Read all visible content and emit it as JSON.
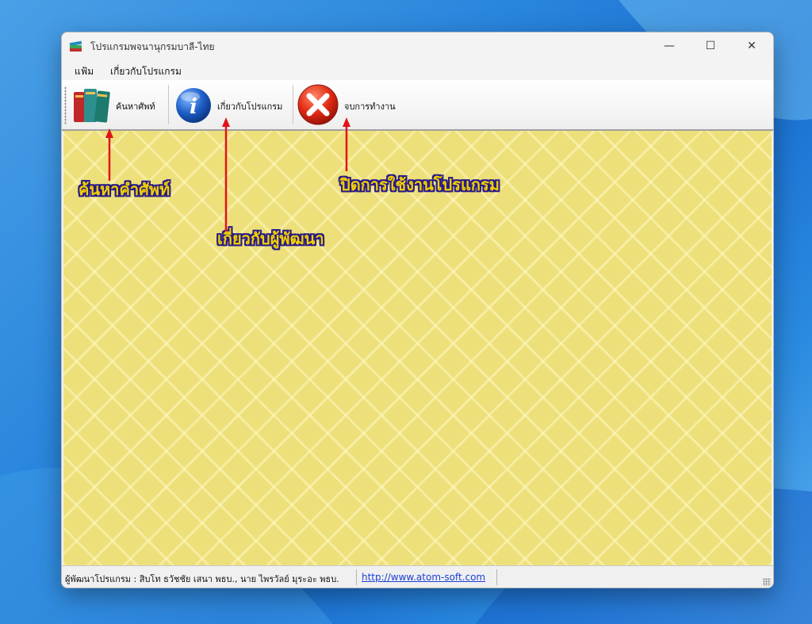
{
  "window": {
    "title": "โปรแกรมพจนานุกรมบาลี-ไทย",
    "controls": {
      "minimize": "—",
      "maximize": "☐",
      "close": "✕"
    }
  },
  "menu": {
    "items": [
      {
        "label": "แฟ้ม"
      },
      {
        "label": "เกี่ยวกับโปรแกรม"
      }
    ]
  },
  "toolbar": {
    "search_label": "ค้นหาศัพท์",
    "about_label": "เกี่ยวกับโปรแกรม",
    "exit_label": "จบการทำงาน"
  },
  "annotations": {
    "search": "ค้นหาคำศัพท์",
    "about": "เกี่ยวกับผู้พัฒนา",
    "exit": "ปิดการใช้งานโปรแกรม"
  },
  "status": {
    "developer": "ผู้พัฒนาโปรแกรม : สิบโท ธวัชชัย  เสนา พธบ., นาย ไพรวัลย์  มุระอะ พธบ.",
    "link": "http://www.atom-soft.com"
  },
  "colors": {
    "content_bg": "#ede07a",
    "annotation_text": "#f0d000",
    "annotation_outline": "#2a1b8a",
    "arrow": "#e0141a",
    "link": "#1a3fd6"
  },
  "icons": {
    "app": "books-icon",
    "search": "books-icon",
    "about": "info-icon",
    "exit": "close-icon"
  }
}
